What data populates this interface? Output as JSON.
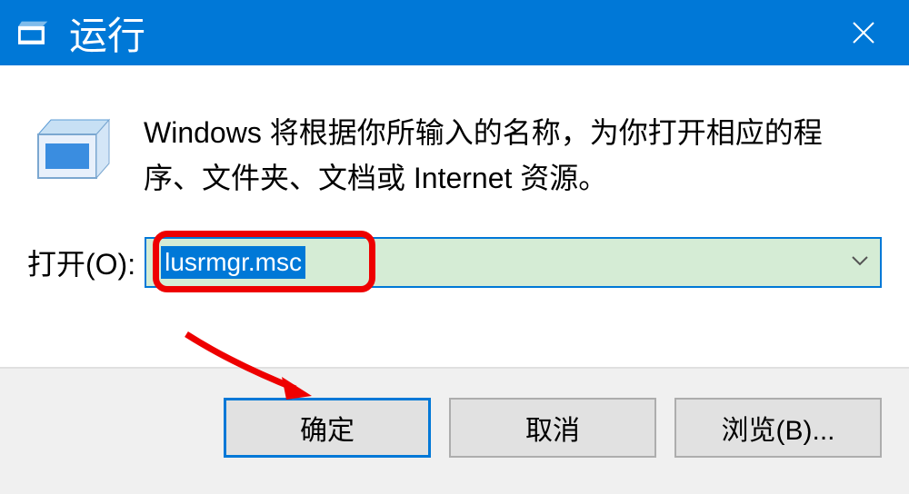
{
  "window": {
    "title": "运行"
  },
  "content": {
    "description": "Windows 将根据你所输入的名称，为你打开相应的程序、文件夹、文档或 Internet 资源。",
    "open_label": "打开(O):",
    "command_value": "lusrmgr.msc"
  },
  "buttons": {
    "ok": "确定",
    "cancel": "取消",
    "browse": "浏览(B)..."
  }
}
